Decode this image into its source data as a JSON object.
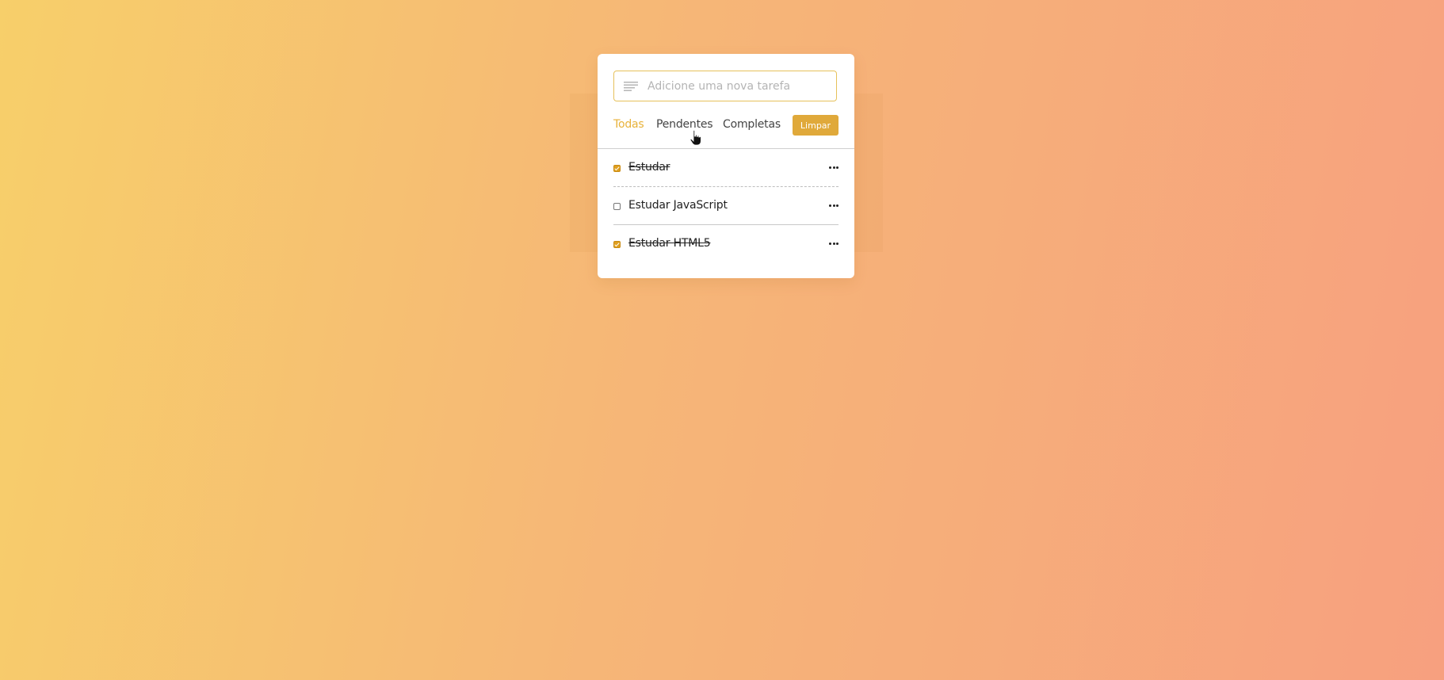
{
  "input": {
    "placeholder": "Adicione uma nova tarefa",
    "value": "",
    "icon": "text-lines-icon"
  },
  "filters": {
    "all": "Todas",
    "pending": "Pendentes",
    "completed": "Completas",
    "active": "all"
  },
  "clear_label": "Limpar",
  "tasks": [
    {
      "label": "Estudar",
      "checked": true
    },
    {
      "label": "Estudar JavaScript",
      "checked": false
    },
    {
      "label": "Estudar HTML5",
      "checked": true
    }
  ],
  "colors": {
    "accent": "#e8b23a",
    "button": "#e0a93a",
    "background_start": "#f7cf6a",
    "background_end": "#f7a07f"
  }
}
